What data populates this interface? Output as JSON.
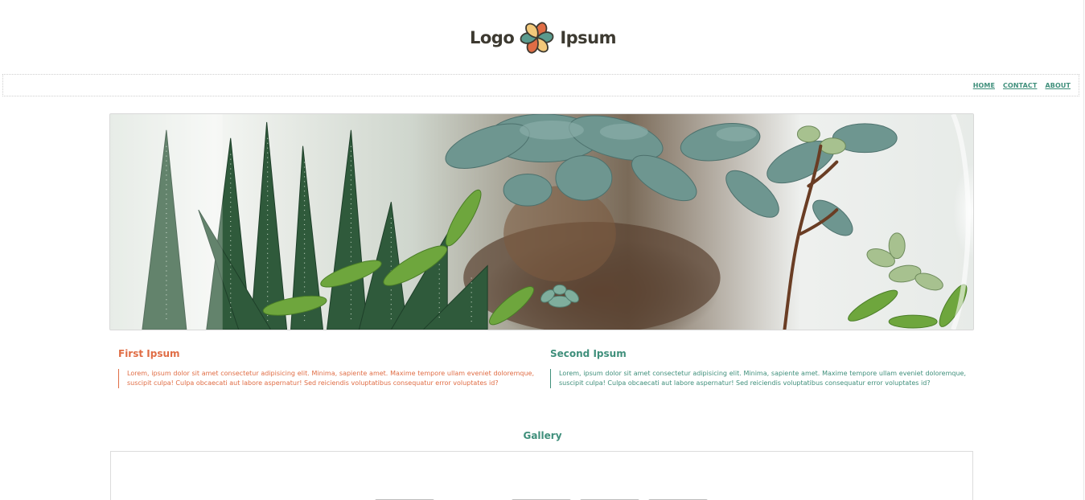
{
  "header": {
    "logo_left": "Logo",
    "logo_right": "Ipsum"
  },
  "nav": {
    "items": [
      {
        "label": "HOME"
      },
      {
        "label": "CONTACT"
      },
      {
        "label": "ABOUT"
      }
    ]
  },
  "sections": [
    {
      "title": "First Ipsum",
      "text": "Lorem, ipsum dolor sit amet consectetur adipisicing elit. Minima, sapiente amet. Maxime tempore ullam eveniet doloremque, suscipit culpa! Culpa obcaecati aut labore aspernatur! Sed reiciendis voluptatibus consequatur error voluptates id?"
    },
    {
      "title": "Second Ipsum",
      "text": "Lorem, ipsum dolor sit amet consectetur adipisicing elit. Minima, sapiente amet. Maxime tempore ullam eveniet doloremque, suscipit culpa! Culpa obcaecati aut labore aspernatur! Sed reiciendis voluptatibus consequatur error voluptates id?"
    }
  ],
  "gallery": {
    "title": "Gallery"
  },
  "colors": {
    "accent_orange": "#e06d45",
    "accent_green": "#3f8f7b",
    "logo_dark": "#3d3a31"
  },
  "icons": {
    "logo_mark": "flower-pinwheel-icon"
  }
}
